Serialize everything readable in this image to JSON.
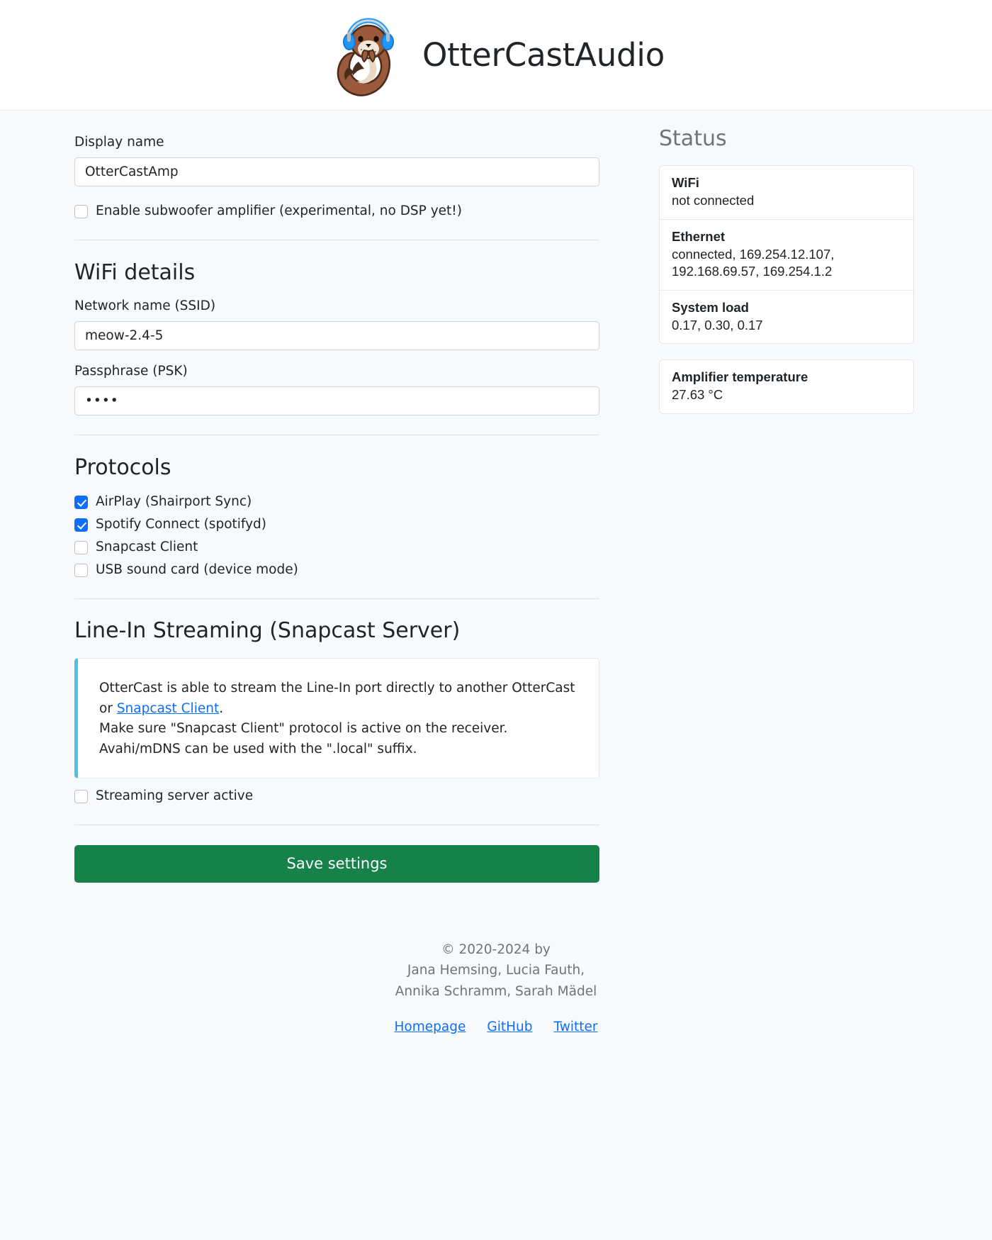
{
  "header": {
    "app_title": "OtterCastAudio",
    "logo_icon": "otter-with-headphones-logo"
  },
  "form": {
    "display_name": {
      "label": "Display name",
      "value": "OtterCastAmp",
      "placeholder": "Display name"
    },
    "subwoofer": {
      "label": "Enable subwoofer amplifier (experimental, no DSP yet!)",
      "checked": false
    },
    "wifi_section": {
      "title": "WiFi details",
      "ssid": {
        "label": "Network name (SSID)",
        "value": "meow-2.4-5",
        "placeholder": "Network name (SSID)"
      },
      "psk": {
        "label": "Passphrase (PSK)",
        "value": "••••",
        "placeholder": "Passphrase (PSK)"
      }
    },
    "protocols_section": {
      "title": "Protocols",
      "items": [
        {
          "label": "AirPlay (Shairport Sync)",
          "checked": true
        },
        {
          "label": "Spotify Connect (spotifyd)",
          "checked": true
        },
        {
          "label": "Snapcast Client",
          "checked": false
        },
        {
          "label": "USB sound card (device mode)",
          "checked": false
        }
      ]
    },
    "linein_section": {
      "title": "Line-In Streaming (Snapcast Server)",
      "info": {
        "line1_before_link": "OtterCast is able to stream the Line-In port directly to another OtterCast or ",
        "link_text": "Snapcast Client",
        "line1_after_link": ".",
        "line2": "Make sure \"Snapcast Client\" protocol is active on the receiver.",
        "line3": "Avahi/mDNS can be used with the \".local\" suffix."
      },
      "streaming_active": {
        "label": "Streaming server active",
        "checked": false
      }
    },
    "save_button": "Save settings"
  },
  "status": {
    "title": "Status",
    "card1": [
      {
        "label": "WiFi",
        "value": "not connected"
      },
      {
        "label": "Ethernet",
        "value": "connected, 169.254.12.107, 192.168.69.57, 169.254.1.2"
      },
      {
        "label": "System load",
        "value": "0.17, 0.30, 0.17"
      }
    ],
    "card2": [
      {
        "label": "Amplifier temperature",
        "value": "27.63 °C"
      }
    ]
  },
  "footer": {
    "copyright": "© 2020-2024 by",
    "authors_line1": "Jana Hemsing, Lucia Fauth,",
    "authors_line2": "Annika Schramm, Sarah Mädel",
    "links": [
      "Homepage",
      "GitHub",
      "Twitter"
    ]
  },
  "colors": {
    "accent_blue": "#0d6efd",
    "save_green": "#17814a",
    "info_border": "#4cc4e0",
    "page_bg": "#f8f9fa",
    "muted": "#6c757d"
  }
}
